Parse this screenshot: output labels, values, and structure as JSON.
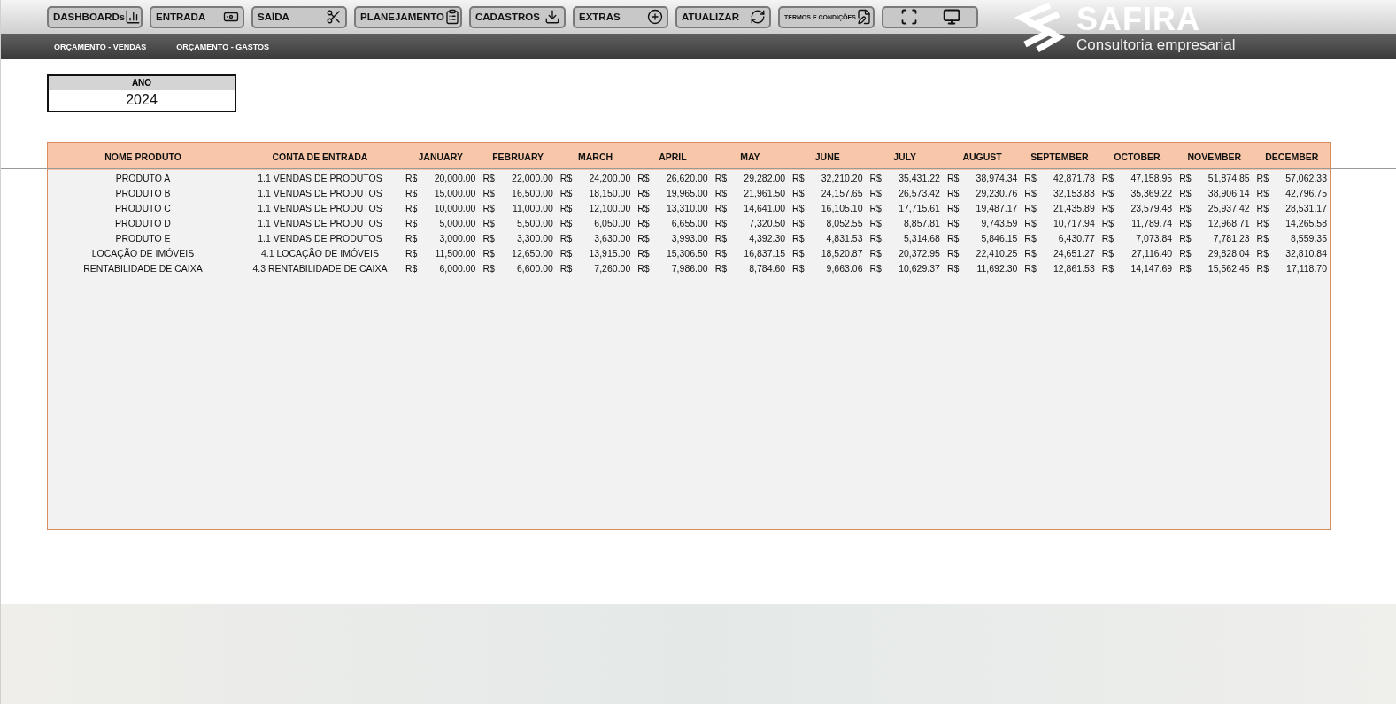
{
  "toolbar": {
    "buttons": [
      {
        "label": "DASHBOARDs",
        "small": false
      },
      {
        "label": "ENTRADA",
        "small": false
      },
      {
        "label": "SAÍDA",
        "small": false
      },
      {
        "label": "PLANEJAMENTO",
        "small": false
      },
      {
        "label": "CADASTROS",
        "small": false
      },
      {
        "label": "EXTRAS",
        "small": false
      },
      {
        "label": "ATUALIZAR",
        "small": false
      },
      {
        "label": "TERMOS E CONDIÇÕES",
        "small": true
      }
    ]
  },
  "logo": {
    "name": "SAFIRA",
    "tagline": "Consultoria empresarial"
  },
  "submenu": [
    {
      "label": "ORÇAMENTO - VENDAS"
    },
    {
      "label": "ORÇAMENTO - GASTOS"
    }
  ],
  "year_filter": {
    "label": "ANO",
    "value": "2024"
  },
  "table": {
    "columns": [
      "NOME PRODUTO",
      "CONTA DE ENTRADA",
      "JANUARY",
      "FEBRUARY",
      "MARCH",
      "APRIL",
      "MAY",
      "JUNE",
      "JULY",
      "AUGUST",
      "SEPTEMBER",
      "OCTOBER",
      "NOVEMBER",
      "DECEMBER"
    ],
    "rows": [
      {
        "name": "PRODUTO A",
        "account": "1.1 VENDAS DE PRODUTOS",
        "values": [
          {
            "currency": "R$",
            "amount": "20,000.00"
          },
          {
            "currency": "R$",
            "amount": "22,000.00"
          },
          {
            "currency": "R$",
            "amount": "24,200.00"
          },
          {
            "currency": "R$",
            "amount": "26,620.00"
          },
          {
            "currency": "R$",
            "amount": "29,282.00"
          },
          {
            "currency": "R$",
            "amount": "32,210.20"
          },
          {
            "currency": "R$",
            "amount": "35,431.22"
          },
          {
            "currency": "R$",
            "amount": "38,974.34"
          },
          {
            "currency": "R$",
            "amount": "42,871.78"
          },
          {
            "currency": "R$",
            "amount": "47,158.95"
          },
          {
            "currency": "R$",
            "amount": "51,874.85"
          },
          {
            "currency": "R$",
            "amount": "57,062.33"
          }
        ]
      },
      {
        "name": "PRODUTO B",
        "account": "1.1 VENDAS DE PRODUTOS",
        "values": [
          {
            "currency": "R$",
            "amount": "15,000.00"
          },
          {
            "currency": "R$",
            "amount": "16,500.00"
          },
          {
            "currency": "R$",
            "amount": "18,150.00"
          },
          {
            "currency": "R$",
            "amount": "19,965.00"
          },
          {
            "currency": "R$",
            "amount": "21,961.50"
          },
          {
            "currency": "R$",
            "amount": "24,157.65"
          },
          {
            "currency": "R$",
            "amount": "26,573.42"
          },
          {
            "currency": "R$",
            "amount": "29,230.76"
          },
          {
            "currency": "R$",
            "amount": "32,153.83"
          },
          {
            "currency": "R$",
            "amount": "35,369.22"
          },
          {
            "currency": "R$",
            "amount": "38,906.14"
          },
          {
            "currency": "R$",
            "amount": "42,796.75"
          }
        ]
      },
      {
        "name": "PRODUTO C",
        "account": "1.1 VENDAS DE PRODUTOS",
        "values": [
          {
            "currency": "R$",
            "amount": "10,000.00"
          },
          {
            "currency": "R$",
            "amount": "11,000.00"
          },
          {
            "currency": "R$",
            "amount": "12,100.00"
          },
          {
            "currency": "R$",
            "amount": "13,310.00"
          },
          {
            "currency": "R$",
            "amount": "14,641.00"
          },
          {
            "currency": "R$",
            "amount": "16,105.10"
          },
          {
            "currency": "R$",
            "amount": "17,715.61"
          },
          {
            "currency": "R$",
            "amount": "19,487.17"
          },
          {
            "currency": "R$",
            "amount": "21,435.89"
          },
          {
            "currency": "R$",
            "amount": "23,579.48"
          },
          {
            "currency": "R$",
            "amount": "25,937.42"
          },
          {
            "currency": "R$",
            "amount": "28,531.17"
          }
        ]
      },
      {
        "name": "PRODUTO D",
        "account": "1.1 VENDAS DE PRODUTOS",
        "values": [
          {
            "currency": "R$",
            "amount": "5,000.00"
          },
          {
            "currency": "R$",
            "amount": "5,500.00"
          },
          {
            "currency": "R$",
            "amount": "6,050.00"
          },
          {
            "currency": "R$",
            "amount": "6,655.00"
          },
          {
            "currency": "R$",
            "amount": "7,320.50"
          },
          {
            "currency": "R$",
            "amount": "8,052.55"
          },
          {
            "currency": "R$",
            "amount": "8,857.81"
          },
          {
            "currency": "R$",
            "amount": "9,743.59"
          },
          {
            "currency": "R$",
            "amount": "10,717.94"
          },
          {
            "currency": "R$",
            "amount": "11,789.74"
          },
          {
            "currency": "R$",
            "amount": "12,968.71"
          },
          {
            "currency": "R$",
            "amount": "14,265.58"
          }
        ]
      },
      {
        "name": "PRODUTO E",
        "account": "1.1 VENDAS DE PRODUTOS",
        "values": [
          {
            "currency": "R$",
            "amount": "3,000.00"
          },
          {
            "currency": "R$",
            "amount": "3,300.00"
          },
          {
            "currency": "R$",
            "amount": "3,630.00"
          },
          {
            "currency": "R$",
            "amount": "3,993.00"
          },
          {
            "currency": "R$",
            "amount": "4,392.30"
          },
          {
            "currency": "R$",
            "amount": "4,831.53"
          },
          {
            "currency": "R$",
            "amount": "5,314.68"
          },
          {
            "currency": "R$",
            "amount": "5,846.15"
          },
          {
            "currency": "R$",
            "amount": "6,430.77"
          },
          {
            "currency": "R$",
            "amount": "7,073.84"
          },
          {
            "currency": "R$",
            "amount": "7,781.23"
          },
          {
            "currency": "R$",
            "amount": "8,559.35"
          }
        ]
      },
      {
        "name": "LOCAÇÃO DE IMÓVEIS",
        "account": "4.1 LOCAÇÃO DE IMÓVEIS",
        "values": [
          {
            "currency": "R$",
            "amount": "11,500.00"
          },
          {
            "currency": "R$",
            "amount": "12,650.00"
          },
          {
            "currency": "R$",
            "amount": "13,915.00"
          },
          {
            "currency": "R$",
            "amount": "15,306.50"
          },
          {
            "currency": "R$",
            "amount": "16,837.15"
          },
          {
            "currency": "R$",
            "amount": "18,520.87"
          },
          {
            "currency": "R$",
            "amount": "20,372.95"
          },
          {
            "currency": "R$",
            "amount": "22,410.25"
          },
          {
            "currency": "R$",
            "amount": "24,651.27"
          },
          {
            "currency": "R$",
            "amount": "27,116.40"
          },
          {
            "currency": "R$",
            "amount": "29,828.04"
          },
          {
            "currency": "R$",
            "amount": "32,810.84"
          }
        ]
      },
      {
        "name": "RENTABILIDADE DE CAIXA",
        "account": "4.3 RENTABILIDADE DE CAIXA",
        "values": [
          {
            "currency": "R$",
            "amount": "6,000.00"
          },
          {
            "currency": "R$",
            "amount": "6,600.00"
          },
          {
            "currency": "R$",
            "amount": "7,260.00"
          },
          {
            "currency": "R$",
            "amount": "7,986.00"
          },
          {
            "currency": "R$",
            "amount": "8,784.60"
          },
          {
            "currency": "R$",
            "amount": "9,663.06"
          },
          {
            "currency": "R$",
            "amount": "10,629.37"
          },
          {
            "currency": "R$",
            "amount": "11,692.30"
          },
          {
            "currency": "R$",
            "amount": "12,861.53"
          },
          {
            "currency": "R$",
            "amount": "14,147.69"
          },
          {
            "currency": "R$",
            "amount": "15,562.45"
          },
          {
            "currency": "R$",
            "amount": "17,118.70"
          }
        ]
      }
    ]
  }
}
